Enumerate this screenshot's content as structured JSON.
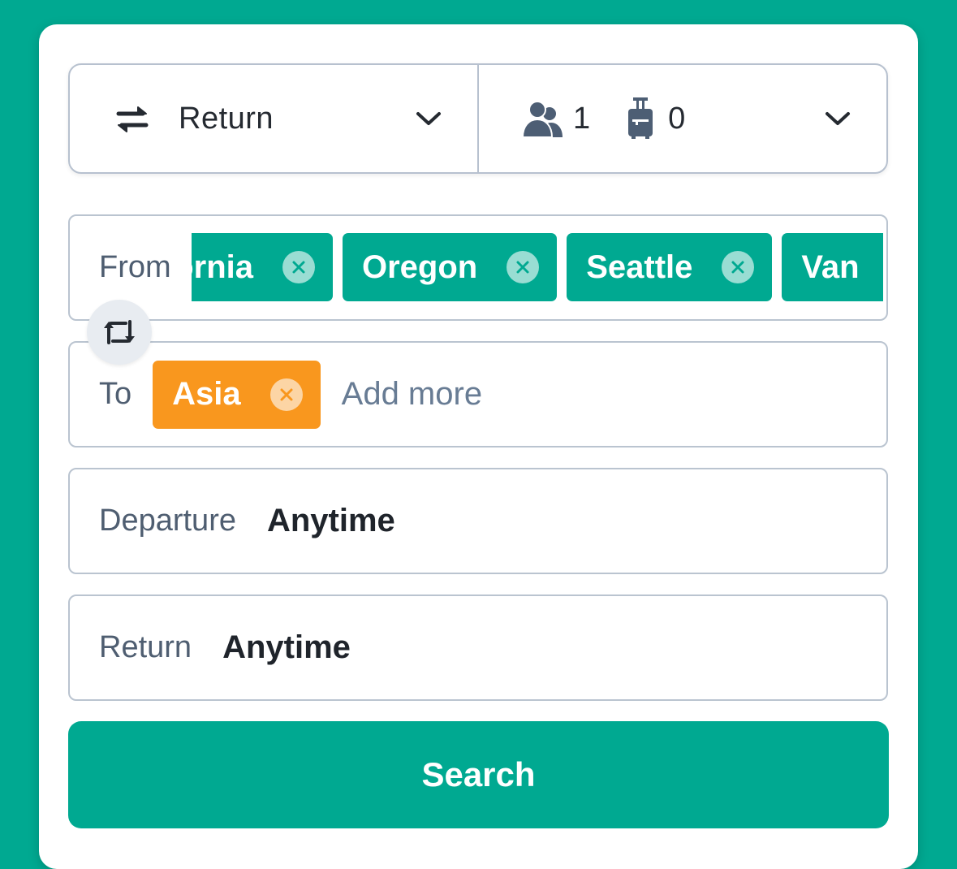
{
  "colors": {
    "brand_green": "#00a991",
    "chip_orange": "#f9971e",
    "border": "#b7c1cf",
    "label_text": "#4f5e71",
    "value_text": "#1f242b"
  },
  "trip_type": {
    "icon": "swap-arrows-icon",
    "label": "Return",
    "chevron": "chevron-down-icon"
  },
  "passengers": {
    "passenger_icon": "people-icon",
    "passenger_count": "1",
    "bag_icon": "luggage-icon",
    "bag_count": "0",
    "chevron": "chevron-down-icon"
  },
  "from": {
    "label": "From",
    "chips": [
      {
        "label": "California",
        "visible_text": "rnia",
        "close_icon": "close-circle-icon"
      },
      {
        "label": "Oregon",
        "close_icon": "close-circle-icon"
      },
      {
        "label": "Seattle",
        "close_icon": "close-circle-icon"
      },
      {
        "label": "Van",
        "close_icon": "close-circle-icon"
      }
    ]
  },
  "swap_button": {
    "icon": "swap-direction-icon"
  },
  "to": {
    "label": "To",
    "chips": [
      {
        "label": "Asia",
        "close_icon": "close-circle-icon"
      }
    ],
    "placeholder": "Add more"
  },
  "departure": {
    "label": "Departure",
    "value": "Anytime"
  },
  "return": {
    "label": "Return",
    "value": "Anytime"
  },
  "search_button": {
    "label": "Search"
  }
}
